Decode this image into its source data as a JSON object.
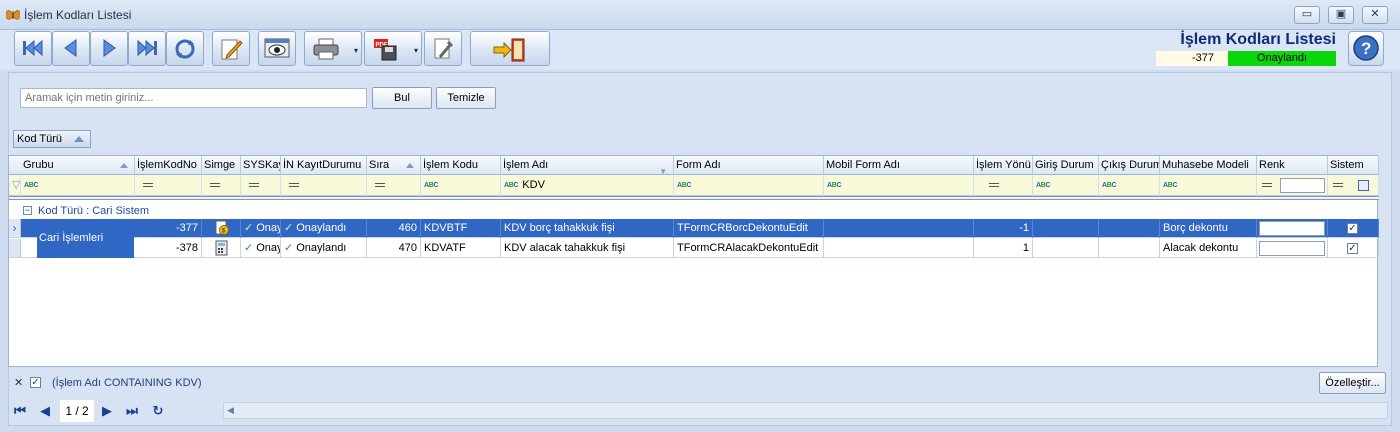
{
  "window": {
    "title": "İşlem Kodları Listesi",
    "min_glyph": "▭",
    "max_glyph": "▣",
    "close_glyph": "✕"
  },
  "toolbar": {
    "icons": [
      "first-record-icon",
      "previous-record-icon",
      "next-record-icon",
      "last-record-icon",
      "refresh-icon",
      "edit-icon",
      "preview-icon",
      "print-icon",
      "pdf-save-icon",
      "tools-icon",
      "exit-icon"
    ],
    "dropdown_glyph": "▾"
  },
  "header": {
    "title": "İşlem Kodları Listesi",
    "record_code": "-377",
    "status": "Onaylandı",
    "status_color": "#0ad60a"
  },
  "search": {
    "placeholder": "Aramak için metin giriniz...",
    "find_label": "Bul",
    "clear_label": "Temizle"
  },
  "group_panel": {
    "chip_label": "Kod Türü"
  },
  "grid": {
    "columns": [
      "Grubu",
      "İşlemKodNo",
      "Simge",
      "SYSKayıt",
      "İN KayıtDurumu",
      "Sıra",
      "İşlem Kodu",
      "İşlem Adı",
      "Form Adı",
      "Mobil Form Adı",
      "İşlem Yönü",
      "Giriş Durum",
      "Çıkış Durum",
      "Muhasebe Modeli",
      "Renk",
      "Sistem"
    ],
    "filter_text": "KDV",
    "abc_a": "A",
    "abc_b": "B",
    "abc_c": "C",
    "group_box_glyph": "−",
    "group_label": "Kod Türü : Cari Sistem",
    "group_value": "Cari İşlemleri",
    "row_indicator": "›",
    "check_glyph": "✓",
    "checkbox_glyph": "✓",
    "rows": [
      {
        "no": "-377",
        "sys": "Onay",
        "status": "Onaylandı",
        "sira": "460",
        "kod": "KDVBTF",
        "ad": "KDV borç tahakkuk fişi",
        "form": "TFormCRBorcDekontuEdit",
        "mobil": "",
        "yon": "-1",
        "giris": "",
        "cikis": "",
        "model": "Borç dekontu",
        "sistem": true
      },
      {
        "no": "-378",
        "sys": "Onay",
        "status": "Onaylandı",
        "sira": "470",
        "kod": "KDVATF",
        "ad": "KDV alacak tahakkuk fişi",
        "form": "TFormCRAlacakDekontuEdit",
        "mobil": "",
        "yon": "1",
        "giris": "",
        "cikis": "",
        "model": "Alacak dekontu",
        "sistem": true
      }
    ]
  },
  "footer": {
    "close_glyph": "✕",
    "check_glyph": "✓",
    "filter_expression": "(İşlem Adı CONTAINING KDV)",
    "customize_label": "Özelleştir...",
    "page_indicator": "1 / 2",
    "nav_first": "⏮",
    "nav_prev": "◀",
    "nav_next": "▶",
    "nav_last": "⏭",
    "nav_refresh": "↻",
    "scroll_left": "◀"
  }
}
